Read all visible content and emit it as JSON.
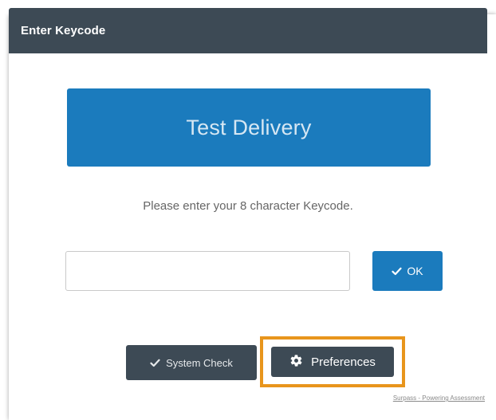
{
  "dialog": {
    "title": "Enter Keycode"
  },
  "banner": {
    "text": "Test Delivery"
  },
  "instructions": "Please enter your 8 character Keycode.",
  "keycode_input": {
    "value": "",
    "placeholder": ""
  },
  "buttons": {
    "ok_label": "OK",
    "system_check_label": "System Check",
    "preferences_label": "Preferences"
  },
  "footer": {
    "link_text": "Surpass - Powering Assessment"
  },
  "icons": {
    "ok": "check-icon",
    "system_check": "check-icon",
    "preferences": "gear-icon"
  },
  "colors": {
    "header_bg": "#3d4a55",
    "accent_blue": "#1b7bbd",
    "highlight_orange": "#e8951c"
  }
}
